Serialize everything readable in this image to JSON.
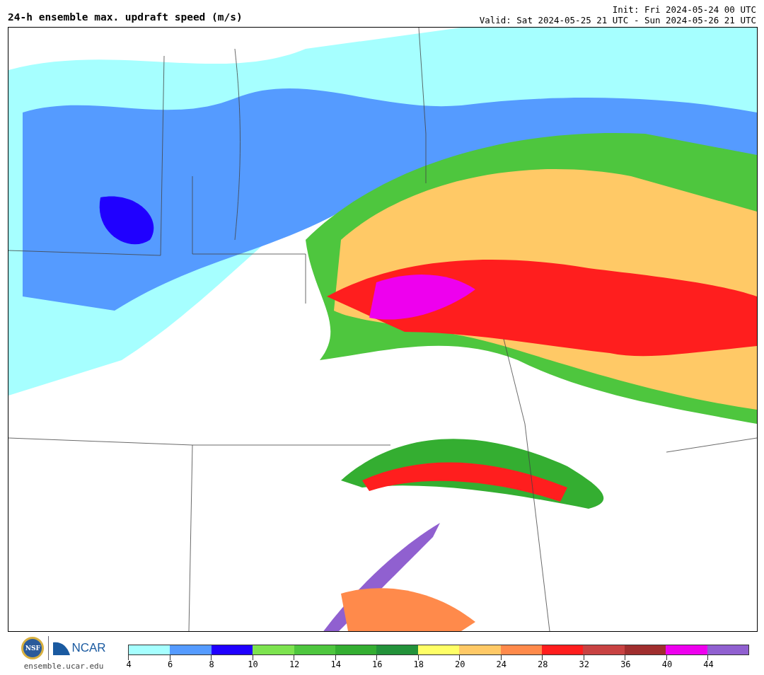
{
  "header": {
    "title": "24-h ensemble max. updraft speed (m/s)",
    "init": "Init: Fri 2024-05-24 00 UTC",
    "valid": "Valid: Sat 2024-05-25 21 UTC - Sun 2024-05-26 21 UTC"
  },
  "footer": {
    "seal_text": "NSF",
    "logo_text": "NCAR",
    "site": "ensemble.ucar.edu"
  },
  "legend": [
    {
      "label": "4",
      "color": "#a6ffff"
    },
    {
      "label": "6",
      "color": "#559bff"
    },
    {
      "label": "8",
      "color": "#2000ff"
    },
    {
      "label": "10",
      "color": "#7de34f"
    },
    {
      "label": "12",
      "color": "#4ec63e"
    },
    {
      "label": "14",
      "color": "#34ae31"
    },
    {
      "label": "16",
      "color": "#23923a"
    },
    {
      "label": "18",
      "color": "#ffff66"
    },
    {
      "label": "20",
      "color": "#ffc966"
    },
    {
      "label": "24",
      "color": "#ff8a4b"
    },
    {
      "label": "28",
      "color": "#ff1e1e"
    },
    {
      "label": "32",
      "color": "#c84242"
    },
    {
      "label": "36",
      "color": "#a02e2e"
    },
    {
      "label": "40",
      "color": "#ee00ee"
    },
    {
      "label": "44",
      "color": "#9060d0"
    }
  ]
}
